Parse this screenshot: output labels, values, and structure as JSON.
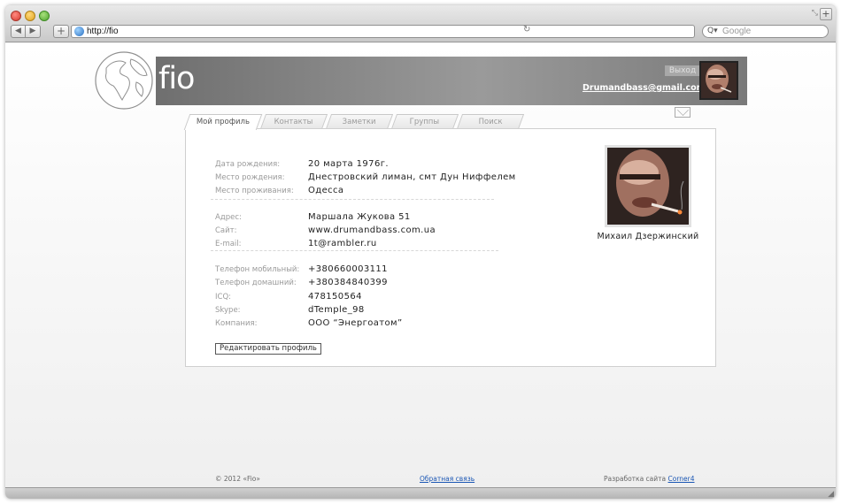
{
  "browser": {
    "url": "http://fio",
    "search_placeholder": "Google",
    "reload_glyph": "↻",
    "search_glyph": "Q▾"
  },
  "site": {
    "logo": "fio",
    "exit_label": "Выход",
    "user_email": "Drumandbass@gmail.com"
  },
  "tabs": [
    {
      "label": "Мой профиль",
      "active": true
    },
    {
      "label": "Контакты",
      "active": false
    },
    {
      "label": "Заметки",
      "active": false
    },
    {
      "label": "Группы",
      "active": false
    },
    {
      "label": "Поиск",
      "active": false
    }
  ],
  "profile": {
    "name": "Михаил Дзержинский",
    "rows": [
      {
        "label": "Дата рождения:",
        "value": "20 марта 1976г."
      },
      {
        "label": "Место рождения:",
        "value": "Днестровский лиман, смт Дун Ниффелем"
      },
      {
        "label": "Место проживания:",
        "value": "Одесса"
      },
      {
        "label": "Адрес:",
        "value": "Маршала Жукова 51"
      },
      {
        "label": "Сайт:",
        "value": "www.drumandbass.com.ua"
      },
      {
        "label": "E-mail:",
        "value": "1t@rambler.ru"
      },
      {
        "label": "Телефон мобильный:",
        "value": "+380660003111"
      },
      {
        "label": "Телефон домашний:",
        "value": "+380384840399"
      },
      {
        "label": "ICQ:",
        "value": "478150564"
      },
      {
        "label": "Skype:",
        "value": "dTemple_98"
      },
      {
        "label": "Компания:",
        "value": "ООО “Энергоатом”"
      }
    ],
    "edit_label": "Редактировать профиль"
  },
  "footer": {
    "copyright": "© 2012 «Fio»",
    "feedback": "Обратная связь",
    "dev_text": "Разработка сайта",
    "dev_link": "Corner4"
  },
  "colors": {
    "header_bg": "#8a8a8a",
    "link": "#1a56b4"
  }
}
